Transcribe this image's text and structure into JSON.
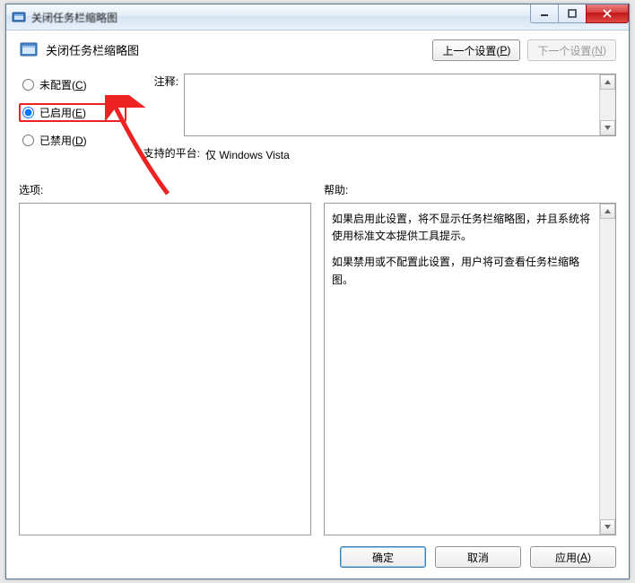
{
  "window": {
    "title": "关闭任务栏缩略图"
  },
  "header": {
    "title": "关闭任务栏缩略图",
    "prev_btn": "上一个设置(",
    "prev_btn_key": "P",
    "prev_btn_tail": ")",
    "next_btn": "下一个设置(",
    "next_btn_key": "N",
    "next_btn_tail": ")"
  },
  "radios": {
    "not_configured": "未配置(",
    "not_configured_key": "C",
    "not_configured_tail": ")",
    "enabled": "已启用(",
    "enabled_key": "E",
    "enabled_tail": ")",
    "disabled": "已禁用(",
    "disabled_key": "D",
    "disabled_tail": ")",
    "selected": "enabled"
  },
  "labels": {
    "comment": "注释:",
    "platform": "支持的平台:",
    "options": "选项:",
    "help": "帮助:"
  },
  "platform_value": "仅 Windows Vista",
  "help": {
    "p1": "如果启用此设置，将不显示任务栏缩略图，并且系统将使用标准文本提供工具提示。",
    "p2": "如果禁用或不配置此设置，用户将可查看任务栏缩略图。"
  },
  "footer": {
    "ok": "确定",
    "cancel": "取消",
    "apply": "应用(",
    "apply_key": "A",
    "apply_tail": ")"
  }
}
